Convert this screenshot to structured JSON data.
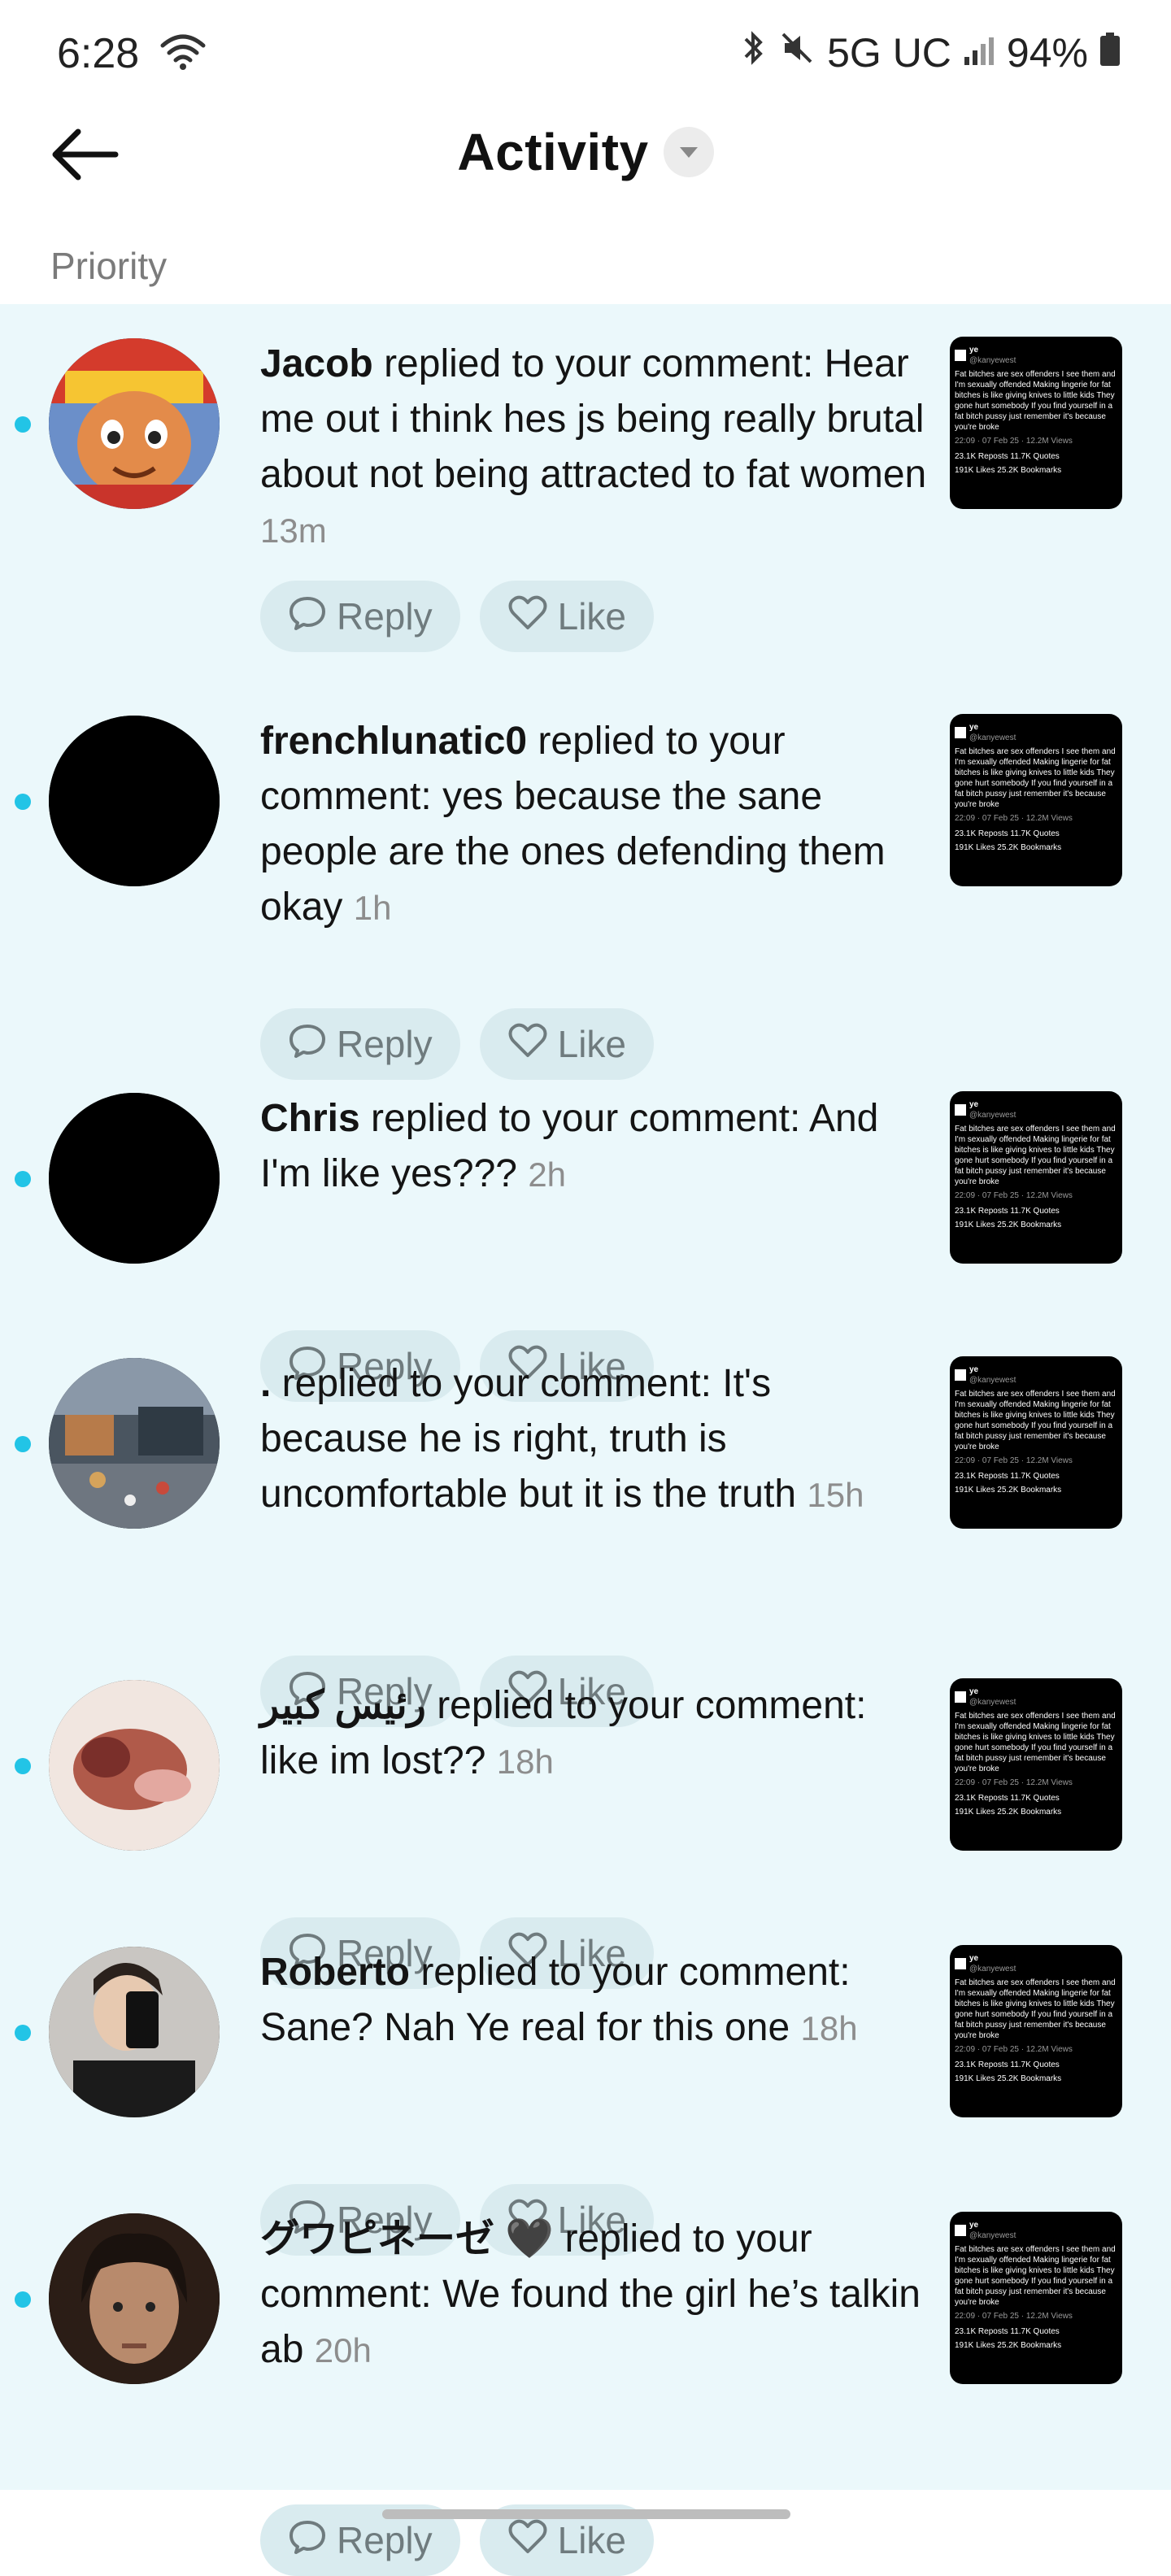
{
  "status": {
    "time": "6:28",
    "network": "5G UC",
    "battery": "94%"
  },
  "header": {
    "title": "Activity"
  },
  "section_label": "Priority",
  "buttons": {
    "reply": "Reply",
    "like": "Like"
  },
  "items": [
    {
      "user": "Jacob",
      "action": " replied to your comment: ",
      "comment": "Hear me out i think hes js being really brutal about not being attracted to fat women",
      "time": "13m"
    },
    {
      "user": "frenchlunatic0",
      "action": " replied to your comment: ",
      "comment": "yes because the sane people are the ones defending them okay",
      "time": "1h"
    },
    {
      "user": "Chris",
      "action": " replied to your comment: ",
      "comment": "And I'm like yes???",
      "time": "2h"
    },
    {
      "user": ".",
      "action": " replied to your comment: ",
      "comment": "It's because he is right, truth is uncomfortable but it is the truth",
      "time": "15h"
    },
    {
      "user": "رئيس كبير",
      "action": " replied to your comment: ",
      "comment": "like im lost??",
      "time": "18h"
    },
    {
      "user": "Roberto",
      "action": " replied to your comment: ",
      "comment": "Sane? Nah Ye real for this one",
      "time": "18h"
    },
    {
      "user": "グワピネーゼ 🖤",
      "action": " replied to your comment: ",
      "comment": "We found the girl he’s talkin ab",
      "time": "20h"
    }
  ],
  "thumbnail": {
    "author": "ye",
    "handle": "@kanyewest",
    "text": "Fat bitches are sex offenders   I see them and I'm sexually offended Making lingerie for fat bitches is like giving knives to little kids  They gone hurt somebody  If you find yourself in a fat bitch pussy just remember it's because you're broke",
    "meta": "22:09 · 07 Feb 25 · 12.2M Views",
    "stats": "23.1K Reposts  11.7K Quotes",
    "likes": "191K Likes  25.2K Bookmarks"
  }
}
